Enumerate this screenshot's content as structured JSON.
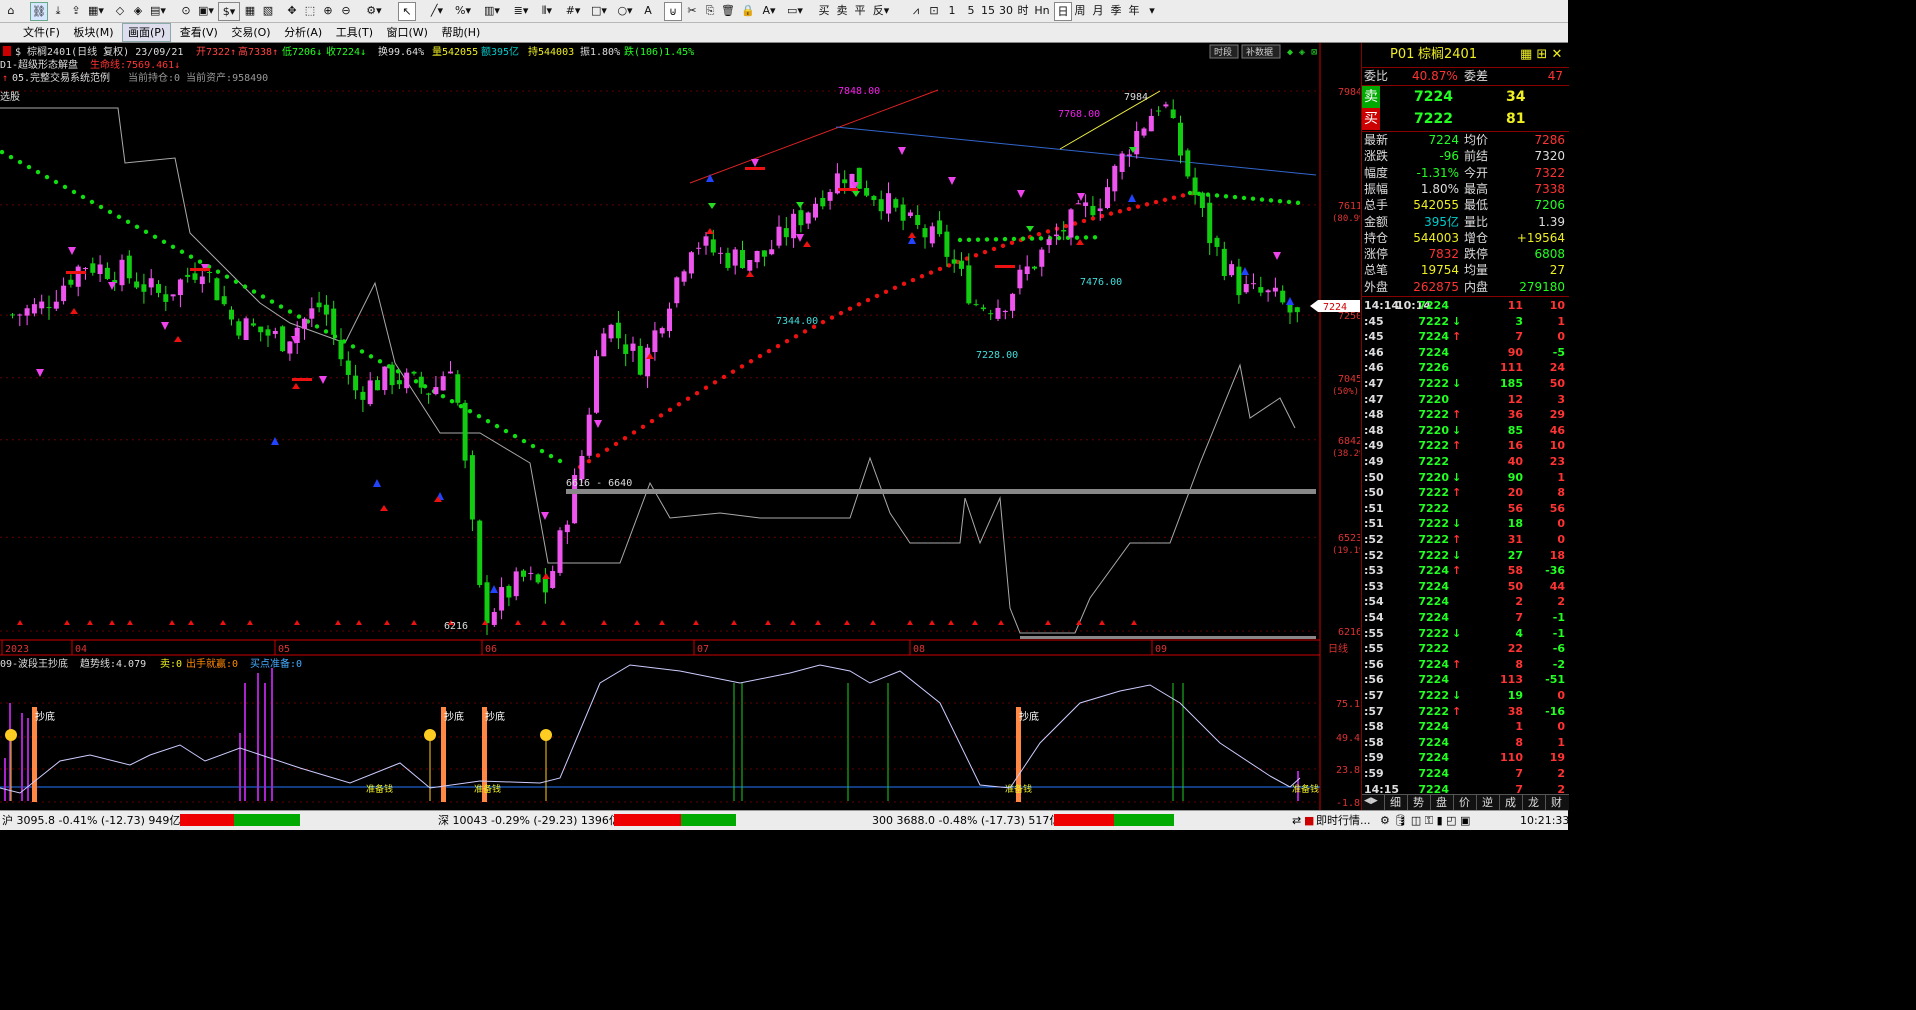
{
  "toolbar": {
    "period_items": [
      "1",
      "5",
      "15",
      "30",
      "时",
      "Hn",
      "日",
      "周",
      "月",
      "季",
      "年"
    ]
  },
  "menu": [
    "文件(F)",
    "板块(M)",
    "画面(P)",
    "查看(V)",
    "交易(O)",
    "分析(A)",
    "工具(T)",
    "窗口(W)",
    "帮助(H)"
  ],
  "chart_header": {
    "symbol": "$ 棕榈2401(日线 复权) 23/09/21",
    "open": "开7322↑",
    "high": "高7338↑",
    "low": "低7206↓",
    "close": "收7224↓",
    "turnover": "换99.64%",
    "volume": "量542055",
    "amount": "额395亿",
    "oi": "持544003",
    "amplitude": "振1.80%",
    "change": "跌(106)1.45%",
    "btn_time": "时段",
    "btn_data": "补数据"
  },
  "indicator_lines": {
    "line1_name": "D1-超级形态解盘",
    "line1_val": "生命线:7569.461↓",
    "line2_name": "05.完整交易系统范例",
    "line2_val": "当前持仓:0 当前资产:958490"
  },
  "chart_data": {
    "type": "candlestick",
    "symbol": "棕榈2401",
    "period": "daily",
    "y_ticks": [
      {
        "value": 7984,
        "label": "7984",
        "pct": ""
      },
      {
        "value": 7611,
        "label": "7611",
        "pct": "(80.9%)"
      },
      {
        "value": 7250,
        "label": "7250",
        "pct": ""
      },
      {
        "value": 7045,
        "label": "7045",
        "pct": "(50%)"
      },
      {
        "value": 6842,
        "label": "6842",
        "pct": "(38.2%)"
      },
      {
        "value": 6523,
        "label": "6523",
        "pct": "(19.1%)"
      },
      {
        "value": 6216,
        "label": "6216",
        "pct": ""
      }
    ],
    "x_ticks": [
      "2023",
      "04",
      "05",
      "06",
      "07",
      "08",
      "09",
      "日线"
    ],
    "annotations": [
      "7848.00",
      "7768.00",
      "7984",
      "7476.00",
      "7344.00",
      "7228.00",
      "6616 - 6640",
      "6216",
      "7224"
    ],
    "signals": [
      "多损",
      "空开",
      "多开",
      "空损",
      "空赢",
      "多赢"
    ],
    "sub_indicator": {
      "name": "09-波段王抄底",
      "trend": "趋势线:4.079",
      "buy": "卖:0",
      "signal": "出手就赢:0",
      "ready": "买点准备:0",
      "labels": [
        "抄底",
        "准备钱"
      ],
      "y_ticks": [
        "75.1",
        "49.4",
        "23.8",
        "-1.8"
      ]
    }
  },
  "quote_panel": {
    "code": "P01",
    "name": "棕榈2401",
    "weibi_label": "委比",
    "weibi_val": "40.87%",
    "weicha_label": "委差",
    "weicha_val": "47",
    "sell_label": "卖",
    "sell_price": "7224",
    "sell_vol": "34",
    "buy_label": "买",
    "buy_price": "7222",
    "buy_vol": "81",
    "stats": [
      [
        "最新",
        "7224",
        "均价",
        "7286"
      ],
      [
        "涨跌",
        "-96",
        "前结",
        "7320"
      ],
      [
        "幅度",
        "-1.31%",
        "今开",
        "7322"
      ],
      [
        "振幅",
        "1.80%",
        "最高",
        "7338"
      ],
      [
        "总手",
        "542055",
        "最低",
        "7206"
      ],
      [
        "金额",
        "395亿",
        "量比",
        "1.39"
      ],
      [
        "持仓",
        "544003",
        "增仓",
        "+19564"
      ],
      [
        "涨停",
        "7832",
        "跌停",
        "6808"
      ],
      [
        "总笔",
        "19754",
        "均量",
        "27"
      ],
      [
        "外盘",
        "262875",
        "内盘",
        "279180"
      ]
    ],
    "ticks": [
      [
        "14:14",
        "10:14",
        "7224",
        "",
        "11",
        "10"
      ],
      [
        ":45",
        "",
        "7222",
        "↓",
        "3",
        "1"
      ],
      [
        ":45",
        "",
        "7224",
        "↑",
        "7",
        "0"
      ],
      [
        ":46",
        "",
        "7224",
        "",
        "90",
        "-5"
      ],
      [
        ":46",
        "",
        "7226",
        "",
        "111",
        "24"
      ],
      [
        ":47",
        "",
        "7222",
        "↓",
        "185",
        "50"
      ],
      [
        ":47",
        "",
        "7220",
        "",
        "12",
        "3"
      ],
      [
        ":48",
        "",
        "7222",
        "↑",
        "36",
        "29"
      ],
      [
        ":48",
        "",
        "7220",
        "↓",
        "85",
        "46"
      ],
      [
        ":49",
        "",
        "7222",
        "↑",
        "16",
        "10"
      ],
      [
        ":49",
        "",
        "7222",
        "",
        "40",
        "23"
      ],
      [
        ":50",
        "",
        "7220",
        "↓",
        "90",
        "1"
      ],
      [
        ":50",
        "",
        "7222",
        "↑",
        "20",
        "8"
      ],
      [
        ":51",
        "",
        "7222",
        "",
        "56",
        "56"
      ],
      [
        ":51",
        "",
        "7222",
        "↓",
        "18",
        "0"
      ],
      [
        ":52",
        "",
        "7222",
        "↑",
        "31",
        "0"
      ],
      [
        ":52",
        "",
        "7222",
        "↓",
        "27",
        "18"
      ],
      [
        ":53",
        "",
        "7224",
        "↑",
        "58",
        "-36"
      ],
      [
        ":53",
        "",
        "7224",
        "",
        "50",
        "44"
      ],
      [
        ":54",
        "",
        "7224",
        "",
        "2",
        "2"
      ],
      [
        ":54",
        "",
        "7224",
        "",
        "7",
        "-1"
      ],
      [
        ":55",
        "",
        "7222",
        "↓",
        "4",
        "-1"
      ],
      [
        ":55",
        "",
        "7222",
        "",
        "22",
        "-6"
      ],
      [
        ":56",
        "",
        "7224",
        "↑",
        "8",
        "-2"
      ],
      [
        ":56",
        "",
        "7224",
        "",
        "113",
        "-51"
      ],
      [
        ":57",
        "",
        "7222",
        "↓",
        "19",
        "0"
      ],
      [
        ":57",
        "",
        "7222",
        "↑",
        "38",
        "-16"
      ],
      [
        ":58",
        "",
        "7224",
        "",
        "1",
        "0"
      ],
      [
        ":58",
        "",
        "7224",
        "",
        "8",
        "1"
      ],
      [
        ":59",
        "",
        "7224",
        "",
        "110",
        "19"
      ],
      [
        ":59",
        "",
        "7224",
        "",
        "7",
        "2"
      ],
      [
        "14:15",
        "",
        "7224",
        "",
        "7",
        "2"
      ]
    ],
    "tabs": [
      "细",
      "势",
      "盘",
      "价",
      "逆",
      "成",
      "龙",
      "财"
    ]
  },
  "status_bar": {
    "sh": "沪 3095.8 -0.41% (-12.73) 949亿",
    "sz": "深 10043 -0.29% (-29.23) 1396亿",
    "i300": "300 3688.0 -0.48% (-17.73) 517亿",
    "news": "即时行情...",
    "time": "10:21:33"
  }
}
